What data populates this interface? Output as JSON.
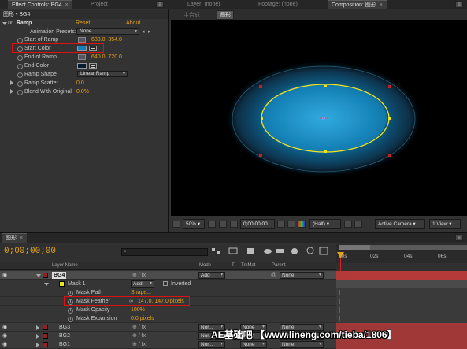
{
  "effect_panel": {
    "tab_label": "Effect Controls: BG4",
    "tab2_label": "Project",
    "breadcrumb": "图形 • BG4",
    "effect_name": "Ramp",
    "fx_label": "fx",
    "reset_label": "Reset",
    "about_label": "About...",
    "presets_label": "Animation Presets:",
    "presets_value": "None",
    "start_of_ramp_label": "Start of Ramp",
    "start_of_ramp_value": "638.0, 354.0",
    "start_color_label": "Start Color",
    "start_color_hex": "#1a7fb8",
    "end_of_ramp_label": "End of Ramp",
    "end_of_ramp_value": "640.0, 720.0",
    "end_color_label": "End Color",
    "end_color_hex": "#041c30",
    "ramp_shape_label": "Ramp Shape",
    "ramp_shape_value": "Linear Ramp",
    "ramp_scatter_label": "Ramp Scatter",
    "ramp_scatter_value": "0.0",
    "blend_label": "Blend With Original",
    "blend_value": "0.0%"
  },
  "comp_panel": {
    "layer_tab": "Layer: (none)",
    "footage_tab": "Footage: (none)",
    "comp_tab": "Composition: 图形",
    "breadcrumbs": [
      "主合成",
      "图形"
    ],
    "zoom": "50%",
    "timecode": "0;00;00;00",
    "resolution": "(Half)",
    "camera": "Active Camera",
    "view": "1 View"
  },
  "timeline": {
    "tab_label": "图形",
    "current_time": "0;00;00;00",
    "search_placeholder": "",
    "columns": {
      "layer_name": "Layer Name",
      "mode": "Mode",
      "t": "T",
      "trkmat": "TrkMat",
      "parent": "Parent"
    },
    "ruler": [
      "00s",
      "02s",
      "04s",
      "06s"
    ],
    "layers": [
      {
        "num": "1",
        "name": "BG4",
        "color": "#9b1e1e",
        "mode": "Add",
        "trkmat": "",
        "parent": "None"
      },
      {
        "num": "2",
        "name": "BG3",
        "color": "#9b1e1e",
        "mode": "Nor...",
        "trkmat": "None",
        "parent": "None"
      },
      {
        "num": "3",
        "name": "BG2",
        "color": "#9b1e1e",
        "mode": "Nor...",
        "trkmat": "None",
        "parent": "None"
      },
      {
        "num": "4",
        "name": "BG1",
        "color": "#9b1e1e",
        "mode": "Nor...",
        "trkmat": "None",
        "parent": "None"
      }
    ],
    "mask": {
      "name": "Mask 1",
      "mode": "Add",
      "inverted_label": "Inverted",
      "path_label": "Mask Path",
      "path_value": "Shape...",
      "feather_label": "Mask Feather",
      "feather_value": "147.0, 147.0 pixels",
      "opacity_label": "Mask Opacity",
      "opacity_value": "100%",
      "expansion_label": "Mask Expansion",
      "expansion_value": "0.0 pixels"
    }
  },
  "watermark": "AE基础吧 【www.lineng.com/tieba/1806】"
}
